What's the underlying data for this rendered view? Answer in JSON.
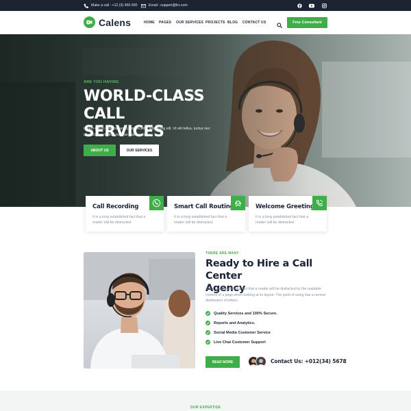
{
  "topbar": {
    "phone": "Make a call : +12 (3) 456 000",
    "email": "Email : support@fcr.com",
    "social": [
      "facebook-icon",
      "youtube-icon",
      "instagram-icon"
    ]
  },
  "nav": {
    "logo": "Calens",
    "menu": [
      "HOME",
      "PAGES",
      "OUR SERVICES",
      "PROJECTS",
      "BLOG",
      "CONTACT US"
    ],
    "cta": "Free Consultant"
  },
  "hero": {
    "kicker": "ARE YOU HAVING",
    "title_line1": "WORLD-CLASS CALL",
    "title_line2": "SERVICES",
    "lead": "Lorem ipsum dolor sit amet, consectetur adipiscing elit. Ut elit tellus, luctus nec ullamcorper mattis, pulvinar dapibus leo.",
    "btn_primary": "ABOUT US",
    "btn_secondary": "OUR SERVICES"
  },
  "cards": [
    {
      "title": "Call Recording",
      "desc": "It is a long established fact that a reader will be distracted.",
      "icon": "call-recording-icon"
    },
    {
      "title": "Smart Call Routing",
      "desc": "It is a long established fact that a reader will be distracted.",
      "icon": "headset-icon"
    },
    {
      "title": "Welcome Greeting",
      "desc": "It is a long established fact that a reader will be distracted.",
      "icon": "phone-hand-icon"
    }
  ],
  "about": {
    "kicker": "THERE ARE MANY",
    "title_line1": "Ready to Hire a Call Center",
    "title_line2": "Agency",
    "text": "It is a long established fact that a reader will be distracted by the readable content of a page when looking at its layout. The point of using  has a normal distribution of letters.",
    "features": [
      "Quality Services and 100% Secure.",
      "Reports and Analytics.",
      "Social Media Customer Service",
      "Live Chat Customer Support"
    ],
    "read_more": "READ MORE",
    "contact": "Contact Us: +012(34) 5678"
  },
  "expertise": {
    "kicker": "OUR EXPERTISE"
  },
  "colors": {
    "accent": "#3fae49",
    "dark": "#1c2333",
    "heading": "#1b2536"
  }
}
